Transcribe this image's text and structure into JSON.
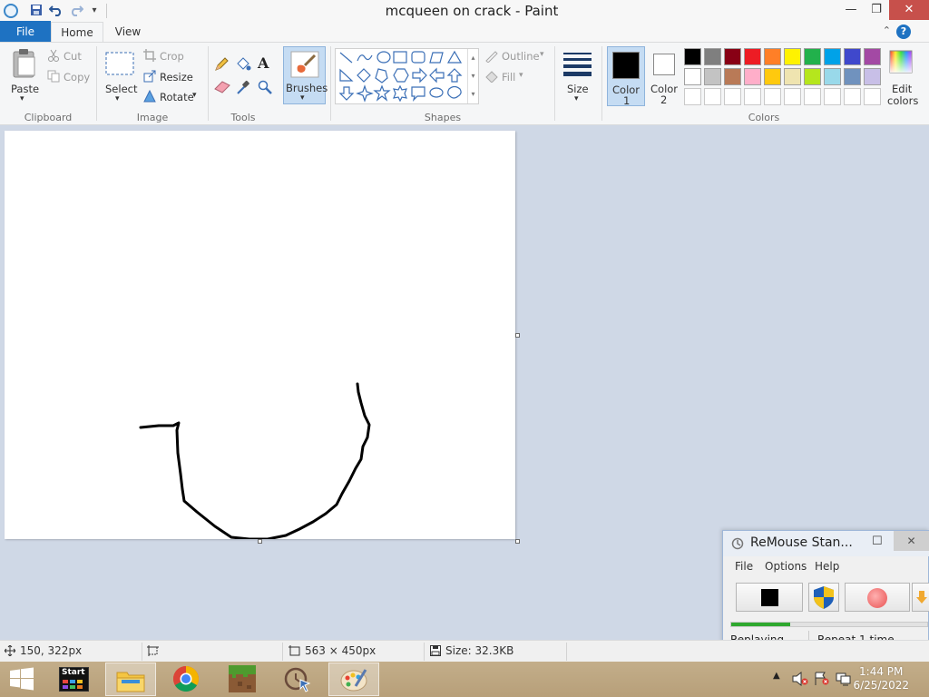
{
  "window": {
    "title": "mcqueen on crack - Paint",
    "minimize_glyph": "—",
    "restore_glyph": "❐",
    "close_glyph": "✕"
  },
  "tabs": {
    "file": "File",
    "home": "Home",
    "view": "View"
  },
  "ribbon": {
    "clipboard": {
      "label": "Clipboard",
      "paste": "Paste",
      "cut": "Cut",
      "copy": "Copy"
    },
    "image": {
      "label": "Image",
      "select": "Select",
      "crop": "Crop",
      "resize": "Resize",
      "rotate": "Rotate"
    },
    "tools": {
      "label": "Tools",
      "text_glyph": "A"
    },
    "brushes": {
      "label": "Brushes"
    },
    "shapes": {
      "label": "Shapes",
      "outline": "Outline",
      "fill": "Fill"
    },
    "size": {
      "label": "Size"
    },
    "colors": {
      "label": "Colors",
      "color1": "Color",
      "color1_num": "1",
      "color2": "Color",
      "color2_num": "2",
      "edit_line1": "Edit",
      "edit_line2": "colors",
      "color1_value": "#000000",
      "color2_value": "#ffffff",
      "palette_row1": [
        "#000000",
        "#7f7f7f",
        "#880015",
        "#ed1c24",
        "#ff7f27",
        "#fff200",
        "#22b14c",
        "#00a2e8",
        "#3f48cc",
        "#a349a4"
      ],
      "palette_row2": [
        "#ffffff",
        "#c3c3c3",
        "#b97a57",
        "#ffaec9",
        "#ffc90e",
        "#efe4b0",
        "#b5e61d",
        "#99d9ea",
        "#7092be",
        "#c8bfe7"
      ]
    }
  },
  "status": {
    "position": "150, 322px",
    "canvas_size": "563 × 450px",
    "file_size": "Size: 32.3KB"
  },
  "remouse": {
    "title": "ReMouse Stan...",
    "menu": [
      "File",
      "Options",
      "Help"
    ],
    "status": "Replaying...",
    "repeat": "Repeat 1 time",
    "progress": 0.3
  },
  "taskbar": {
    "start_label": "Start",
    "time": "1:44 PM",
    "date": "6/25/2022"
  }
}
